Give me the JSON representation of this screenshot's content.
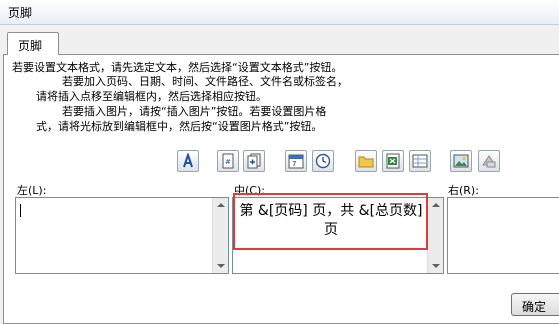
{
  "dialog": {
    "title": "页脚"
  },
  "tab": {
    "label": "页脚"
  },
  "instructions": [
    "若要设置文本格式，请先选定文本，然后选择“设置文本格式”按钮。",
    "若要加入页码、日期、时间、文件路径、文件名或标签名，",
    "请将插入点移至编辑框内，然后选择相应按钮。",
    "若要插入图片，请按“插入图片”按钮。若要设置图片格",
    "式，请将光标放到编辑框中，然后按“设置图片格式”按钮。"
  ],
  "toolbar": {
    "buttons": [
      {
        "name": "format-text",
        "icon": "format-text-icon"
      },
      {
        "name": "insert-page-number",
        "icon": "page-number-icon"
      },
      {
        "name": "insert-number-of-pages",
        "icon": "number-of-pages-icon"
      },
      {
        "name": "insert-date",
        "icon": "date-icon"
      },
      {
        "name": "insert-time",
        "icon": "time-icon"
      },
      {
        "name": "insert-file-path",
        "icon": "file-path-icon"
      },
      {
        "name": "insert-file-name",
        "icon": "file-name-icon"
      },
      {
        "name": "insert-sheet-name",
        "icon": "sheet-name-icon"
      },
      {
        "name": "insert-picture",
        "icon": "picture-icon"
      },
      {
        "name": "format-picture",
        "icon": "format-picture-icon"
      }
    ]
  },
  "sections": {
    "left": {
      "label": "左(L):",
      "value": ""
    },
    "center": {
      "label": "中(C):",
      "value": "第 &[页码] 页，共 &[总页数] 页"
    },
    "right": {
      "label": "右(R):",
      "value": ""
    }
  },
  "footer": {
    "ok_label": "确定"
  }
}
